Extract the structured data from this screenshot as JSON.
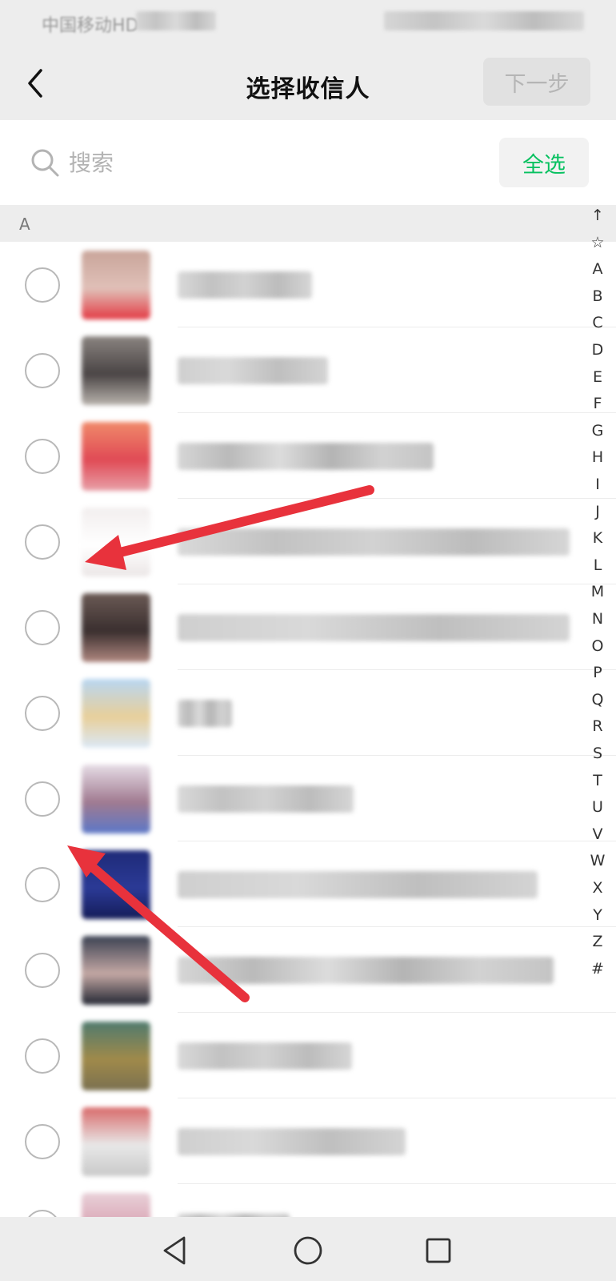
{
  "status_bar": {
    "carrier": "中国移动HD"
  },
  "header": {
    "back_icon": "chevron-left-icon",
    "title": "选择收信人",
    "next_label": "下一步"
  },
  "search": {
    "icon": "search-icon",
    "placeholder": "搜索",
    "select_all_label": "全选"
  },
  "section": {
    "letter": "A"
  },
  "contacts": [
    {
      "avatar_colors": [
        "#c9a59a",
        "#e0c0b8",
        "#e33a44"
      ],
      "selected": false
    },
    {
      "avatar_colors": [
        "#8a8480",
        "#4a4545",
        "#b9b3ad"
      ],
      "selected": false
    },
    {
      "avatar_colors": [
        "#f08a6a",
        "#e04a55",
        "#e8a0a8"
      ],
      "selected": false
    },
    {
      "avatar_colors": [
        "#f2eeee",
        "#ffffff",
        "#ebe6e6"
      ],
      "selected": false
    },
    {
      "avatar_colors": [
        "#6b5a55",
        "#3a2f2f",
        "#b08880"
      ],
      "selected": false
    },
    {
      "avatar_colors": [
        "#b8d6f2",
        "#e8cf9a",
        "#dbe8f6"
      ],
      "selected": false
    },
    {
      "avatar_colors": [
        "#e6dde6",
        "#a07a90",
        "#5c78c8"
      ],
      "selected": false
    },
    {
      "avatar_colors": [
        "#1e2a78",
        "#2b3a96",
        "#141c58"
      ],
      "selected": false
    },
    {
      "avatar_colors": [
        "#3a4152",
        "#c4a8a4",
        "#232733"
      ],
      "selected": false
    },
    {
      "avatar_colors": [
        "#4f7a6e",
        "#a08a4a",
        "#7a7050"
      ],
      "selected": false
    },
    {
      "avatar_colors": [
        "#d86a6a",
        "#e8e8e8",
        "#c8c8c8"
      ],
      "selected": false
    },
    {
      "avatar_colors": [
        "#e8d0d8",
        "#d8a0b0",
        "#f2f2f2"
      ],
      "selected": false
    }
  ],
  "index_letters": [
    "↑",
    "☆",
    "A",
    "B",
    "C",
    "D",
    "E",
    "F",
    "G",
    "H",
    "I",
    "J",
    "K",
    "L",
    "M",
    "N",
    "O",
    "P",
    "Q",
    "R",
    "S",
    "T",
    "U",
    "V",
    "W",
    "X",
    "Y",
    "Z",
    "#"
  ],
  "annotation_color": "#e8323c",
  "nav_bar": {
    "back_icon": "triangle-back-icon",
    "home_icon": "circle-home-icon",
    "recents_icon": "square-recents-icon"
  }
}
